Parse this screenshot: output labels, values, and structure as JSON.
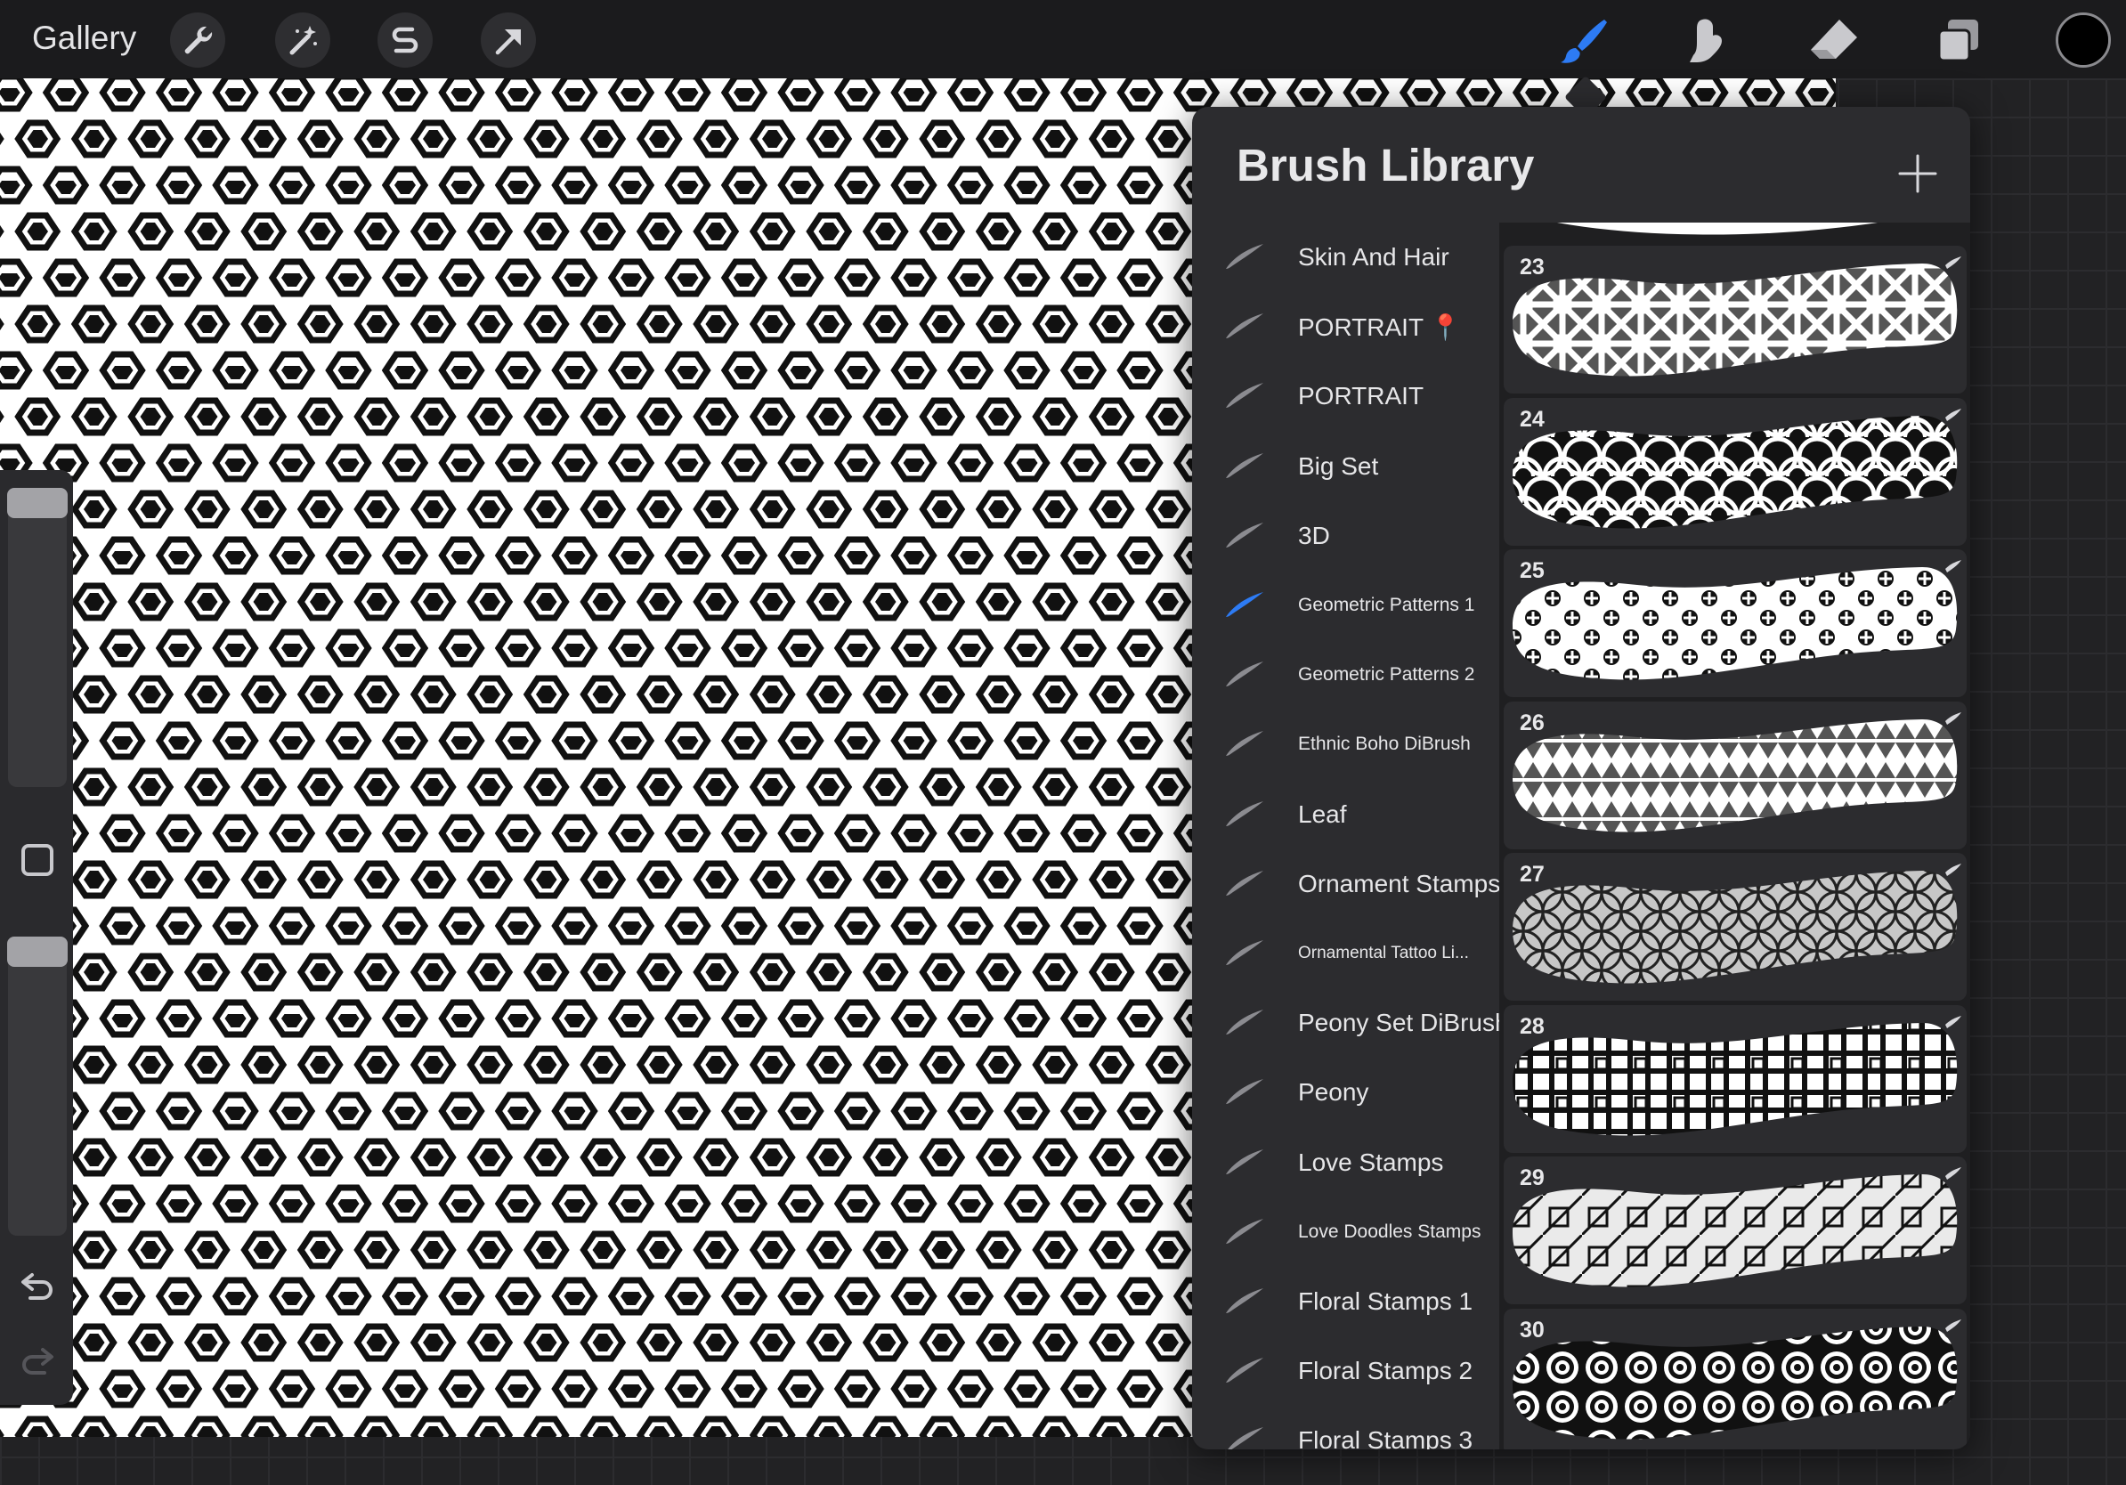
{
  "toolbar": {
    "gallery_label": "Gallery",
    "left_tools": [
      "wrench-icon",
      "magic-wand-icon",
      "selection-s-icon",
      "transform-arrow-icon"
    ],
    "right_tools": [
      "brush-icon",
      "smudge-icon",
      "eraser-icon",
      "layers-icon"
    ],
    "active_tool": "brush-icon",
    "current_color": "#000000",
    "accent_color": "#2d7bf4"
  },
  "panel": {
    "title": "Brush Library",
    "add_icon": "plus-icon"
  },
  "brush_sets": [
    {
      "label": "Skin And Hair",
      "size": "big",
      "active": false
    },
    {
      "label": "PORTRAIT 📍",
      "size": "big",
      "active": false
    },
    {
      "label": "PORTRAIT",
      "size": "big",
      "active": false
    },
    {
      "label": "Big Set",
      "size": "big",
      "active": false
    },
    {
      "label": "3D",
      "size": "big",
      "active": false
    },
    {
      "label": "Geometric Patterns 1",
      "size": "small",
      "active": true
    },
    {
      "label": "Geometric Patterns 2",
      "size": "small",
      "active": false
    },
    {
      "label": "Ethnic Boho DiBrush",
      "size": "small",
      "active": false
    },
    {
      "label": "Leaf",
      "size": "big",
      "active": false
    },
    {
      "label": "Ornament Stamps",
      "size": "big",
      "active": false
    },
    {
      "label": "Ornamental Tattoo Li...",
      "size": "tiny",
      "active": false
    },
    {
      "label": "Peony Set DiBrush",
      "size": "big",
      "active": false
    },
    {
      "label": "Peony",
      "size": "big",
      "active": false
    },
    {
      "label": "Love Stamps",
      "size": "big",
      "active": false
    },
    {
      "label": "Love Doodles Stamps",
      "size": "small",
      "active": false
    },
    {
      "label": "Floral Stamps 1",
      "size": "big",
      "active": false
    },
    {
      "label": "Floral Stamps 2",
      "size": "big",
      "active": false
    },
    {
      "label": "Floral Stamps 3",
      "size": "big",
      "active": false
    }
  ],
  "brushes": [
    {
      "number": "23",
      "pattern": "lattice-x"
    },
    {
      "number": "24",
      "pattern": "scallops"
    },
    {
      "number": "25",
      "pattern": "circle-cross-dots"
    },
    {
      "number": "26",
      "pattern": "triangles"
    },
    {
      "number": "27",
      "pattern": "overlapping-circles"
    },
    {
      "number": "28",
      "pattern": "square-grid"
    },
    {
      "number": "29",
      "pattern": "diagonal-squares"
    },
    {
      "number": "30",
      "pattern": "concentric-circles"
    }
  ],
  "sidebar": {
    "icons": [
      "brush-size-slider",
      "modify-square-icon",
      "brush-opacity-slider",
      "undo-icon",
      "redo-icon"
    ]
  }
}
